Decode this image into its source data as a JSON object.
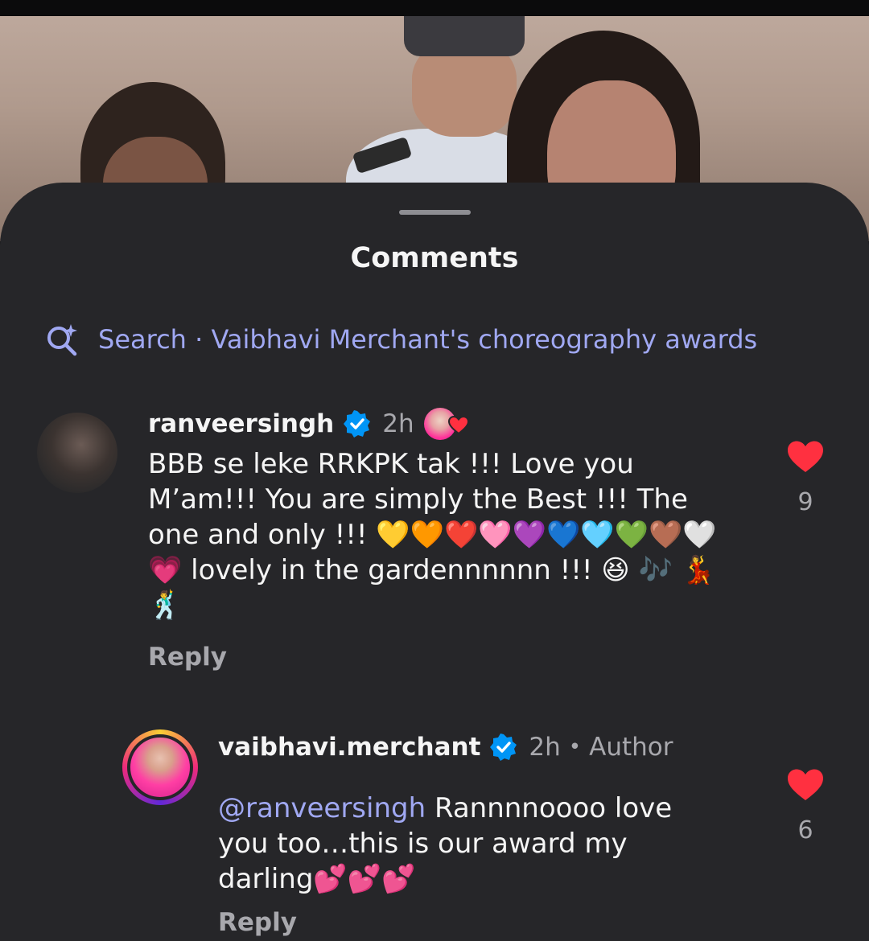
{
  "sheet": {
    "title": "Comments"
  },
  "search": {
    "label": "Search · Vaibhavi Merchant's choreography awards",
    "accent_color": "#a0a8f2"
  },
  "comments": [
    {
      "username": "ranveersingh",
      "verified": true,
      "time": "2h",
      "creator_liked": true,
      "text_lines": [
        "BBB se leke RRKPK tak !!! Love you",
        "M’am!!! You are simply the Best !!! The",
        "one and only !!! 💛🧡❤️🩷💜💙🩵💚🤎🤍",
        "💗 lovely in the gardennnnnn !!! 😆 🎶 💃",
        "🕺"
      ],
      "reply_label": "Reply",
      "like_count": "9",
      "liked": true
    },
    {
      "username": "vaibhavi.merchant",
      "verified": true,
      "time": "2h",
      "separator": "•",
      "author_badge": "Author",
      "mention": "@ranveersingh",
      "text_line_1_rest": " Rannnnoooo love",
      "text_line_2": "you too…this is our award my",
      "text_line_3": "darling💕💕💕",
      "reply_label": "Reply",
      "like_count": "6",
      "liked": true
    }
  ],
  "colors": {
    "sheet_bg": "#262629",
    "heart_red": "#ff3040",
    "verified_blue": "#0095f6",
    "muted_text": "#a8a8ad"
  }
}
